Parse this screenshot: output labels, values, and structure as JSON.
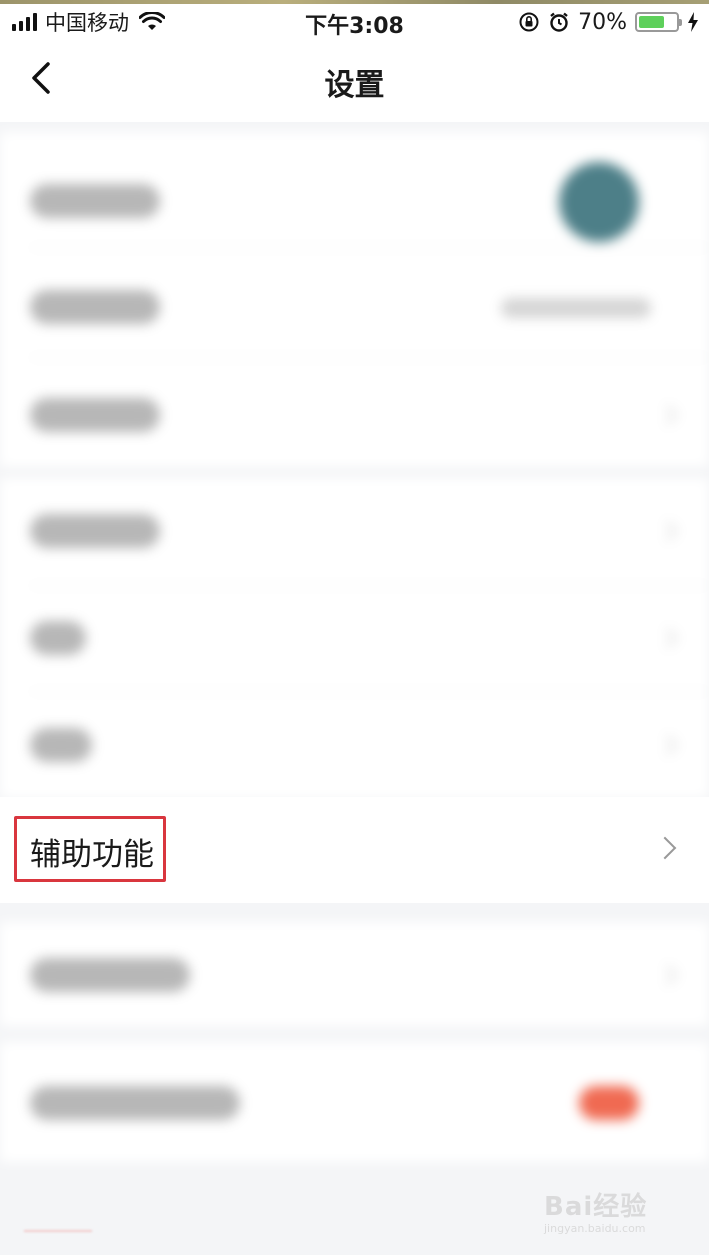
{
  "status_bar": {
    "carrier": "中国移动",
    "time": "下午3:08",
    "battery_percent_label": "70%",
    "battery_level": 0.7,
    "icons": [
      "signal-icon",
      "wifi-icon",
      "orientation-lock-icon",
      "alarm-icon",
      "battery-icon",
      "charging-icon"
    ]
  },
  "header": {
    "title": "设置",
    "back_icon": "chevron-left-icon"
  },
  "settings": {
    "highlighted_item": {
      "label": "辅助功能",
      "icon": "chevron-right-icon",
      "highlight_color": "#d9363e"
    }
  },
  "watermark": {
    "text": "Bai经验",
    "sub": "jingyan.baidu.com"
  },
  "colors": {
    "background": "#f4f5f7",
    "cell": "#ffffff",
    "battery_fill": "#5ed05b",
    "avatar": "#4d7f88",
    "toggle": "#f06a52"
  }
}
